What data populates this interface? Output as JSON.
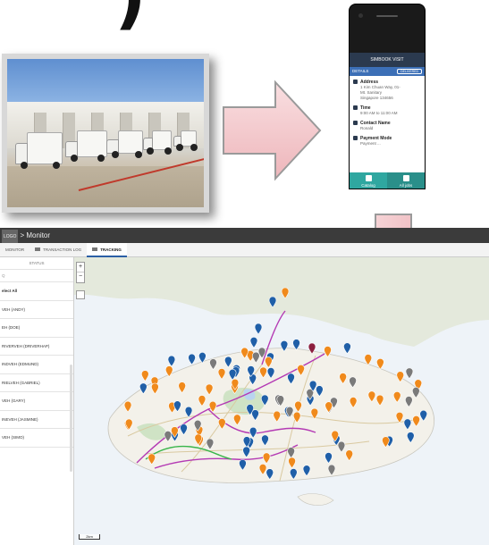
{
  "mark": ")",
  "colors": {
    "arrow_fill": "#f4c9cd",
    "arrow_stroke": "#9a9a9a",
    "app_titlebar": "#3b3b3b",
    "teal": "#2fa7a0",
    "route_purple": "#b43ab4",
    "route_green": "#39b54a",
    "pin_blue": "#1f5fa8",
    "pin_orange": "#f08a1c"
  },
  "photo": {
    "subject": "delivery-trucks-at-warehouse"
  },
  "phone": {
    "app_title": "SIMBOOK VISIT",
    "sub_label": "DETAILS",
    "chip_label": "DELIVERED",
    "address_heading": "Address",
    "address_lines": [
      "1 Kim Chuan Way, 01-",
      "Mt. Sanitary",
      "Singapore 134656"
    ],
    "time_heading": "Time",
    "time_value": "9:00 AM to 11:00 AM",
    "contact_heading": "Contact Name",
    "contact_value": "Ronald",
    "payment_heading": "Payment Mode",
    "payment_value": "Payment ...",
    "tab_left": "Catalog",
    "tab_right": "All jobs"
  },
  "app": {
    "title": "> Monitor",
    "logo": "LOGO",
    "tabs": [
      {
        "label": "MONITOR",
        "active": false
      },
      {
        "label": "TRANSACTION LOG",
        "active": false
      },
      {
        "label": "TRACKING",
        "active": true
      }
    ],
    "status_header": "STATUS",
    "filter_placeholder": "Q",
    "select_all": "elect All",
    "drivers": [
      "VEH (ANDY)",
      "EH (DOE)",
      "RIVERVEH (DRIVERHAP)",
      "INDVEH (EDMUND)",
      "RIELVEH (GABRIEL)",
      "VEH (GARY)",
      "INEVEH (JASMINE)",
      "VEH (SIMO)"
    ],
    "zoom_in": "+",
    "zoom_out": "−",
    "scale_label": "2km"
  }
}
